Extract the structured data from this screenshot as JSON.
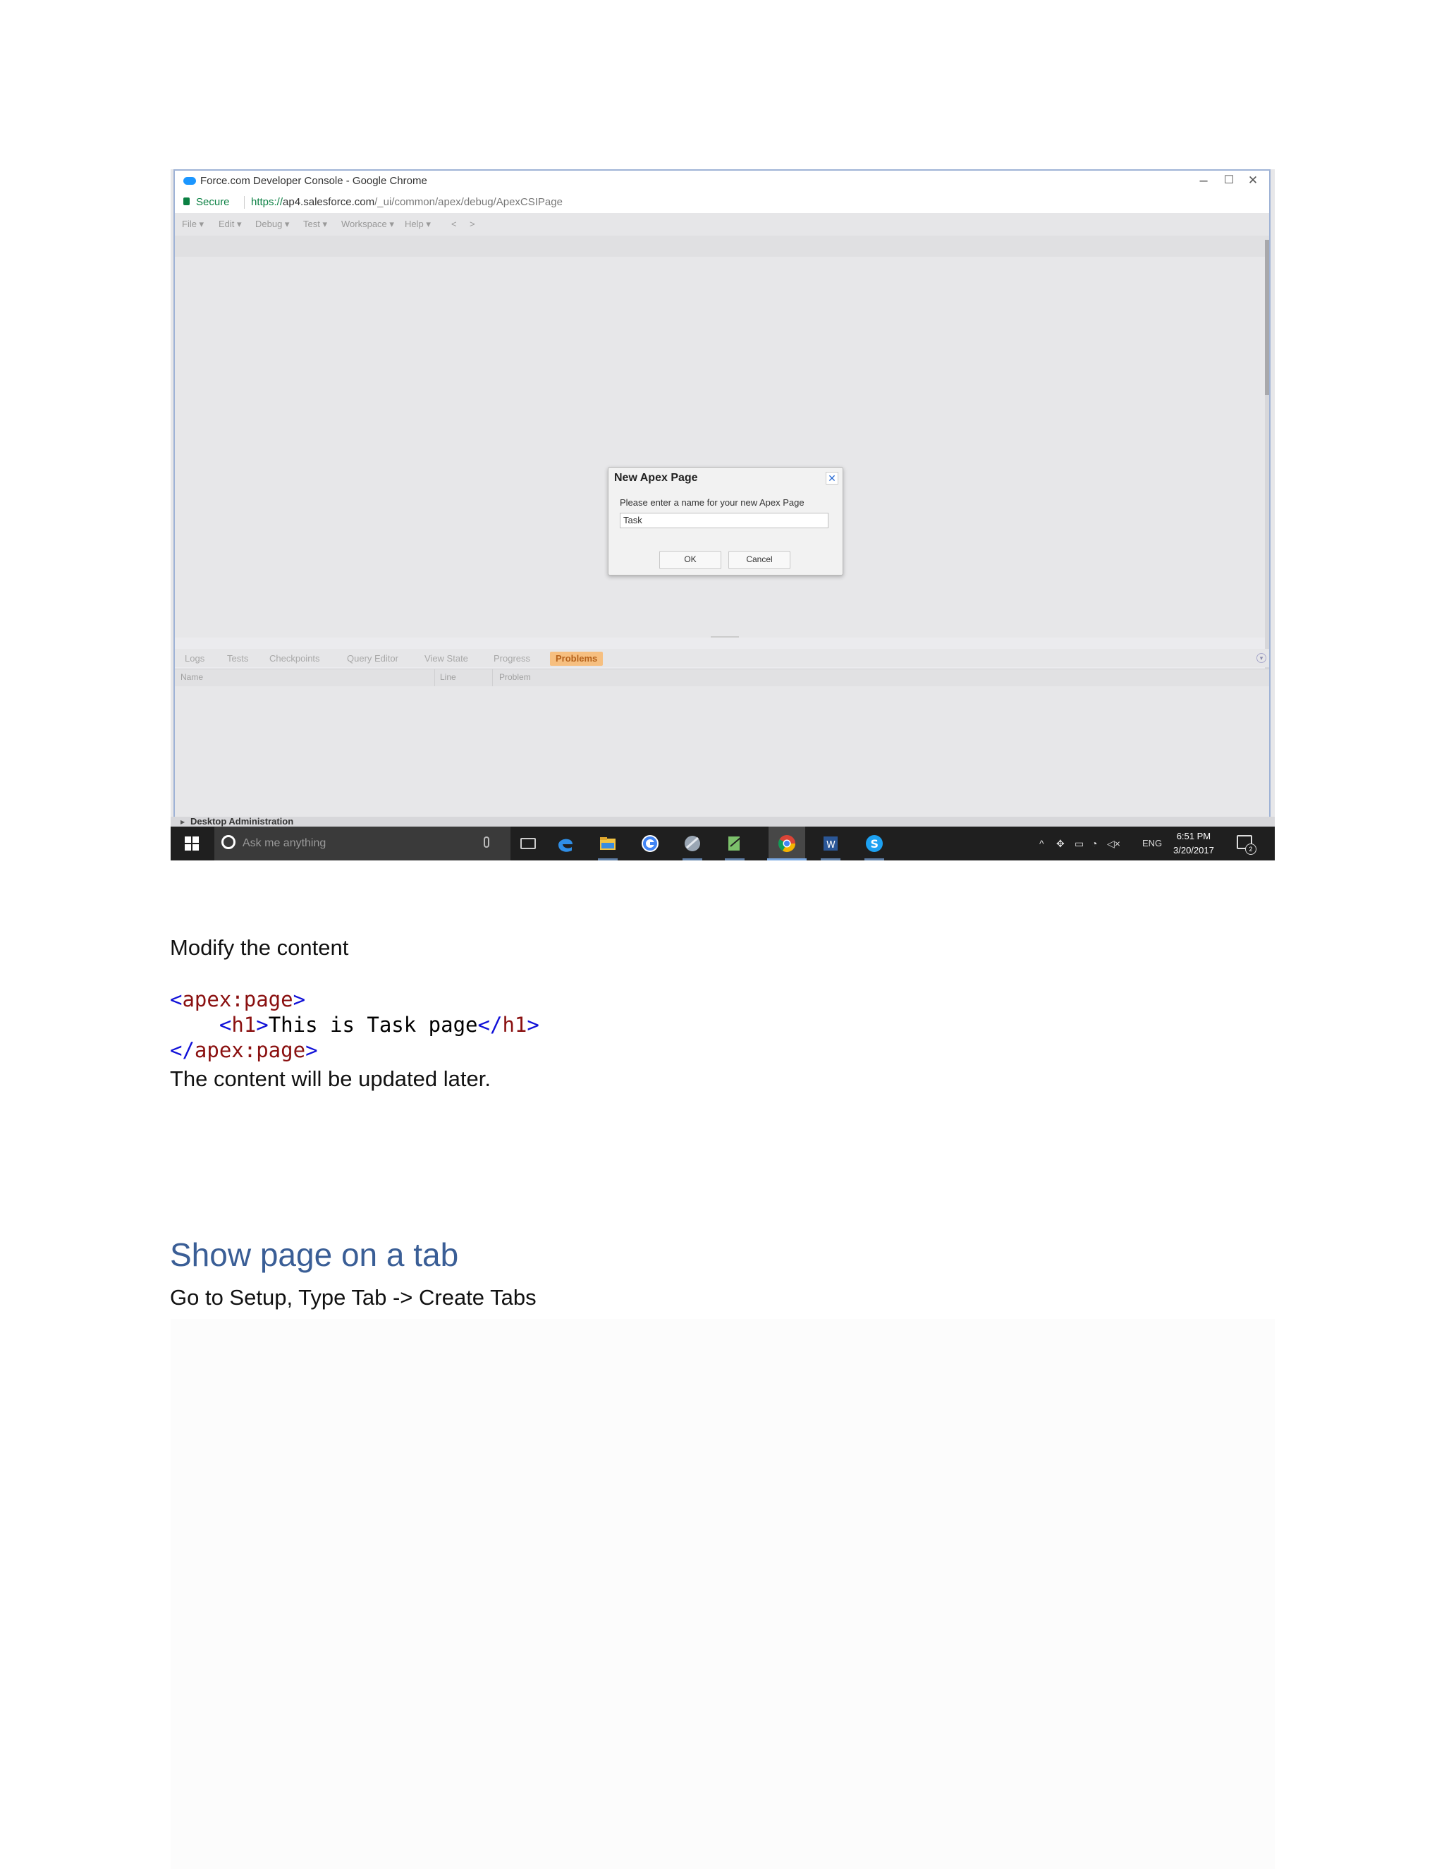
{
  "screenshot": {
    "window_title": "Force.com Developer Console - Google Chrome",
    "window_controls": {
      "minimize": "–",
      "maximize": "☐",
      "close": "✕"
    },
    "address": {
      "secure_label": "Secure",
      "url_scheme": "https://",
      "url_host": "ap4.salesforce.com",
      "url_path": "/_ui/common/apex/debug/ApexCSIPage"
    },
    "menu": [
      {
        "label": "File ▾"
      },
      {
        "label": "Edit ▾"
      },
      {
        "label": "Debug ▾"
      },
      {
        "label": "Test ▾"
      },
      {
        "label": "Workspace ▾"
      },
      {
        "label": "Help ▾"
      },
      {
        "label": "<"
      },
      {
        "label": ">"
      }
    ],
    "dialog": {
      "title": "New Apex Page",
      "close_glyph": "✕",
      "prompt": "Please enter a name for your new Apex Page",
      "input_value": "Task",
      "ok_label": "OK",
      "cancel_label": "Cancel"
    },
    "panel_tabs": [
      {
        "label": "Logs"
      },
      {
        "label": "Tests"
      },
      {
        "label": "Checkpoints"
      },
      {
        "label": "Query Editor"
      },
      {
        "label": "View State"
      },
      {
        "label": "Progress"
      },
      {
        "label": "Problems",
        "active": true
      }
    ],
    "grid_columns": [
      "Name",
      "Line",
      "Problem"
    ],
    "desktop_admin_label": "Desktop Administration",
    "taskbar": {
      "search_placeholder": "Ask me anything",
      "tray_lang": "ENG",
      "clock_time": "6:51 PM",
      "clock_date": "3/20/2017",
      "notification_count": "2",
      "apps": [
        "edge-icon",
        "file-explorer-icon",
        "google-icon",
        "app-icon",
        "notepad-icon",
        "chrome-icon",
        "word-icon",
        "skype-icon"
      ]
    }
  },
  "document": {
    "para_modify": "Modify the content",
    "code_line1_open": "<",
    "code_line1_tag": "apex:page",
    "code_line1_close": ">",
    "code_line2_indent": "    ",
    "code_line2_open": "<",
    "code_line2_tag": "h1",
    "code_line2_close": ">",
    "code_line2_text": "This is Task page",
    "code_line2_end_open": "</",
    "code_line2_end_tag": "h1",
    "code_line2_end_close": ">",
    "code_line3_open": "</",
    "code_line3_tag": "apex:page",
    "code_line3_close": ">",
    "para_updated": "The content will be updated later.",
    "heading": "Show page on a tab",
    "para_setup": "Go to Setup, Type Tab -> Create Tabs"
  },
  "colors": {
    "heading": "#3a5e96",
    "code_bracket": "#1010d8",
    "code_tag": "#8a1010",
    "active_tab": "#f6bf80",
    "secure_green": "#0b8043"
  }
}
